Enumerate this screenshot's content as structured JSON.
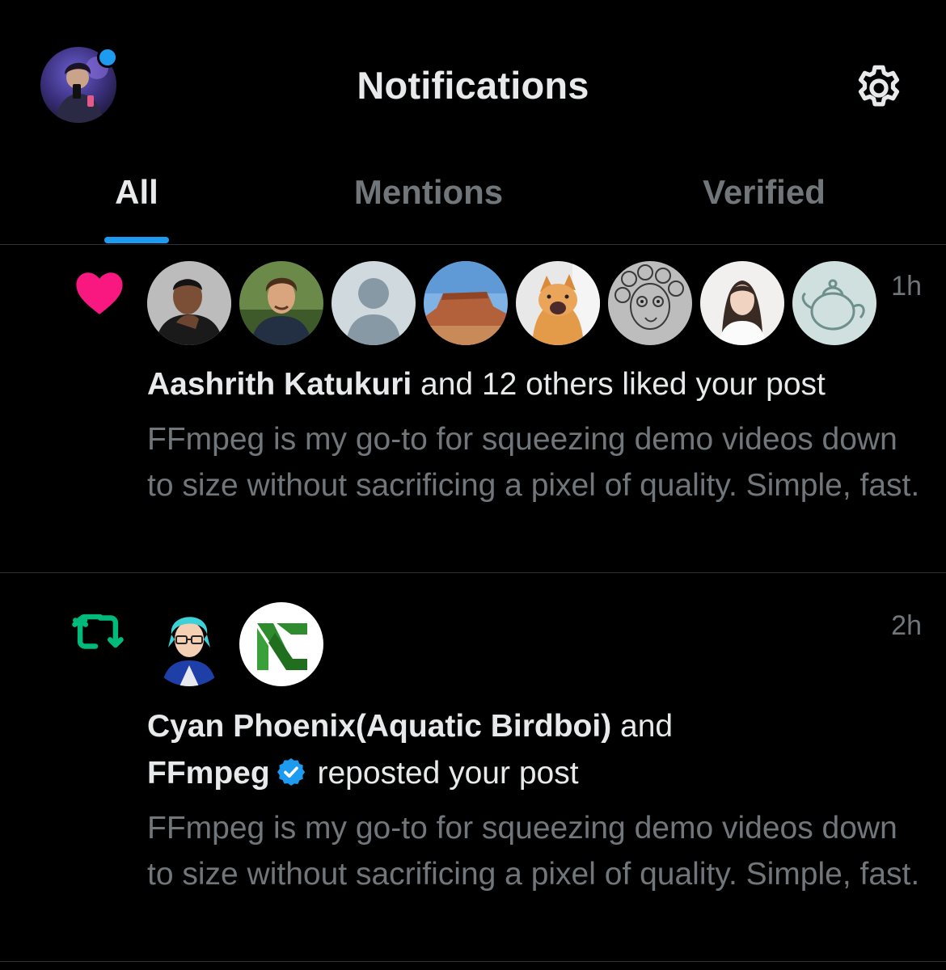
{
  "header": {
    "title": "Notifications",
    "profile_icon": "user-avatar",
    "settings_icon": "gear-icon"
  },
  "tabs": [
    {
      "label": "All",
      "active": true
    },
    {
      "label": "Mentions",
      "active": false
    },
    {
      "label": "Verified",
      "active": false
    }
  ],
  "notifications": [
    {
      "type": "like",
      "type_icon": "heart-icon",
      "time": "1h",
      "actor": "Aashrith Katukuri",
      "action": " and 12 others liked your post",
      "post_text": "FFmpeg is my go-to for squeezing demo videos down to size without sacrificing a pixel of quality. Simple, fast.",
      "avatars": [
        "person-photo",
        "illustrated-man",
        "default-avatar",
        "desert-mesa",
        "cat-photo",
        "sketch-drawing",
        "woman-photo",
        "teapot-drawing"
      ]
    },
    {
      "type": "repost",
      "type_icon": "repost-icon",
      "time": "2h",
      "actor_1": "Cyan Phoenix(Aquatic Birdboi)",
      "connector": " and",
      "actor_2": "FFmpeg",
      "action": " reposted your post",
      "post_text": "FFmpeg is my go-to for squeezing demo videos down to size without sacrificing a pixel of quality. Simple, fast.",
      "avatars": [
        "cyan-anime-character",
        "ffmpeg-logo"
      ]
    }
  ],
  "colors": {
    "background": "#000000",
    "text_primary": "#e7e9ea",
    "text_secondary": "#71767b",
    "accent": "#1d9bf0",
    "like": "#f91880",
    "repost": "#00ba7c",
    "divider": "#2f3336"
  }
}
